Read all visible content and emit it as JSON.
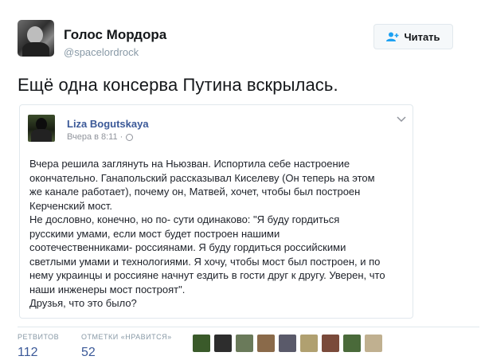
{
  "author": {
    "name": "Голос Мордора",
    "handle": "@spacelordrock"
  },
  "follow_button": {
    "label": "Читать",
    "icon": "add-user-icon"
  },
  "tweet_text": "Ещё одна консерва Путина вскрылась.",
  "quoted_post": {
    "author_name": "Liza Bogutskaya",
    "timestamp": "Вчера в 8:11 ·",
    "privacy_icon": "globe-icon",
    "menu_icon": "chevron-down-icon",
    "lines": [
      "Вчера решила заглянуть на Ньюзван. Испортила себе настроение",
      "окончательно. Ганапольский рассказывал Киселеву (Он теперь на этом",
      "же канале работает), почему он, Матвей, хочет, чтобы был построен",
      "Керченский мост.",
      "Не дословно, конечно, но по- сути одинаково: \"Я буду гордиться",
      "русскими умами, если мост будет построен нашими",
      "соотечественниками- россиянами. Я буду гордиться российскими",
      "светлыми умами и технологиями. Я хочу, чтобы мост был построен, и по",
      "нему украинцы и россияне начнут ездить в гости друг к другу. Уверен, что",
      "наши инженеры мост построят\".",
      "Друзья, что это было?"
    ]
  },
  "stats": {
    "retweets_label": "РЕТВИТОВ",
    "retweets_value": "112",
    "likes_label": "ОТМЕТКИ «НРАВИТСЯ»",
    "likes_value": "52"
  },
  "liker_avatars": [
    "#3a5a2a",
    "#2d2d2d",
    "#6a7a5a",
    "#8a6a4a",
    "#5a5a6a",
    "#b0a070",
    "#7a4a3a",
    "#4a6a3a",
    "#c0b090"
  ]
}
